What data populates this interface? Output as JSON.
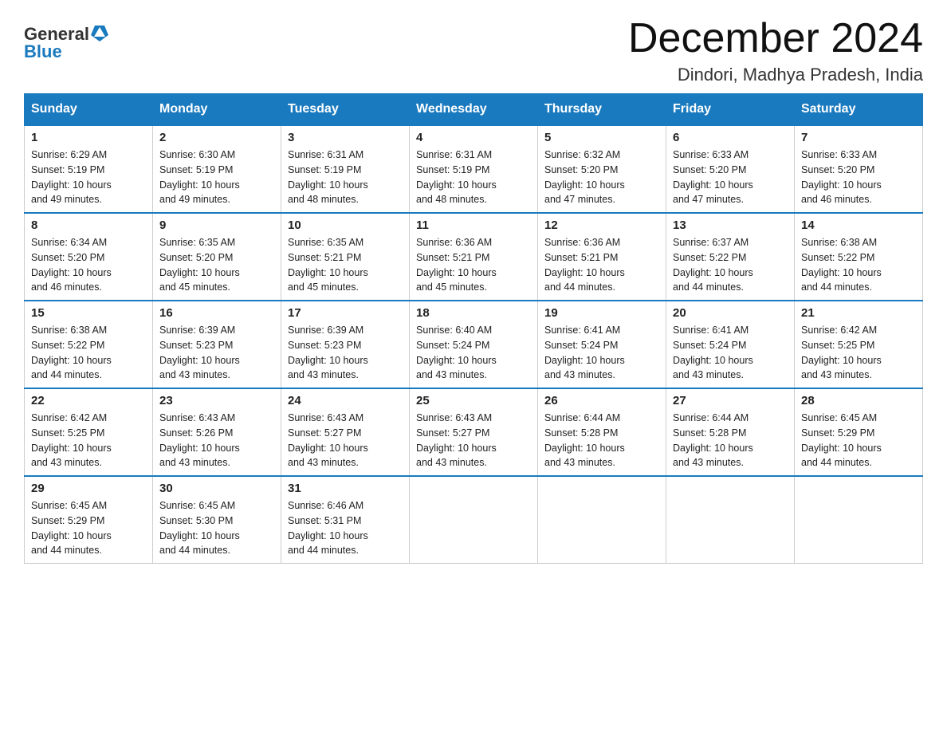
{
  "header": {
    "logo_text_general": "General",
    "logo_text_blue": "Blue",
    "month_title": "December 2024",
    "location": "Dindori, Madhya Pradesh, India"
  },
  "weekdays": [
    "Sunday",
    "Monday",
    "Tuesday",
    "Wednesday",
    "Thursday",
    "Friday",
    "Saturday"
  ],
  "weeks": [
    [
      {
        "day": "1",
        "sunrise": "6:29 AM",
        "sunset": "5:19 PM",
        "daylight": "10 hours and 49 minutes."
      },
      {
        "day": "2",
        "sunrise": "6:30 AM",
        "sunset": "5:19 PM",
        "daylight": "10 hours and 49 minutes."
      },
      {
        "day": "3",
        "sunrise": "6:31 AM",
        "sunset": "5:19 PM",
        "daylight": "10 hours and 48 minutes."
      },
      {
        "day": "4",
        "sunrise": "6:31 AM",
        "sunset": "5:19 PM",
        "daylight": "10 hours and 48 minutes."
      },
      {
        "day": "5",
        "sunrise": "6:32 AM",
        "sunset": "5:20 PM",
        "daylight": "10 hours and 47 minutes."
      },
      {
        "day": "6",
        "sunrise": "6:33 AM",
        "sunset": "5:20 PM",
        "daylight": "10 hours and 47 minutes."
      },
      {
        "day": "7",
        "sunrise": "6:33 AM",
        "sunset": "5:20 PM",
        "daylight": "10 hours and 46 minutes."
      }
    ],
    [
      {
        "day": "8",
        "sunrise": "6:34 AM",
        "sunset": "5:20 PM",
        "daylight": "10 hours and 46 minutes."
      },
      {
        "day": "9",
        "sunrise": "6:35 AM",
        "sunset": "5:20 PM",
        "daylight": "10 hours and 45 minutes."
      },
      {
        "day": "10",
        "sunrise": "6:35 AM",
        "sunset": "5:21 PM",
        "daylight": "10 hours and 45 minutes."
      },
      {
        "day": "11",
        "sunrise": "6:36 AM",
        "sunset": "5:21 PM",
        "daylight": "10 hours and 45 minutes."
      },
      {
        "day": "12",
        "sunrise": "6:36 AM",
        "sunset": "5:21 PM",
        "daylight": "10 hours and 44 minutes."
      },
      {
        "day": "13",
        "sunrise": "6:37 AM",
        "sunset": "5:22 PM",
        "daylight": "10 hours and 44 minutes."
      },
      {
        "day": "14",
        "sunrise": "6:38 AM",
        "sunset": "5:22 PM",
        "daylight": "10 hours and 44 minutes."
      }
    ],
    [
      {
        "day": "15",
        "sunrise": "6:38 AM",
        "sunset": "5:22 PM",
        "daylight": "10 hours and 44 minutes."
      },
      {
        "day": "16",
        "sunrise": "6:39 AM",
        "sunset": "5:23 PM",
        "daylight": "10 hours and 43 minutes."
      },
      {
        "day": "17",
        "sunrise": "6:39 AM",
        "sunset": "5:23 PM",
        "daylight": "10 hours and 43 minutes."
      },
      {
        "day": "18",
        "sunrise": "6:40 AM",
        "sunset": "5:24 PM",
        "daylight": "10 hours and 43 minutes."
      },
      {
        "day": "19",
        "sunrise": "6:41 AM",
        "sunset": "5:24 PM",
        "daylight": "10 hours and 43 minutes."
      },
      {
        "day": "20",
        "sunrise": "6:41 AM",
        "sunset": "5:24 PM",
        "daylight": "10 hours and 43 minutes."
      },
      {
        "day": "21",
        "sunrise": "6:42 AM",
        "sunset": "5:25 PM",
        "daylight": "10 hours and 43 minutes."
      }
    ],
    [
      {
        "day": "22",
        "sunrise": "6:42 AM",
        "sunset": "5:25 PM",
        "daylight": "10 hours and 43 minutes."
      },
      {
        "day": "23",
        "sunrise": "6:43 AM",
        "sunset": "5:26 PM",
        "daylight": "10 hours and 43 minutes."
      },
      {
        "day": "24",
        "sunrise": "6:43 AM",
        "sunset": "5:27 PM",
        "daylight": "10 hours and 43 minutes."
      },
      {
        "day": "25",
        "sunrise": "6:43 AM",
        "sunset": "5:27 PM",
        "daylight": "10 hours and 43 minutes."
      },
      {
        "day": "26",
        "sunrise": "6:44 AM",
        "sunset": "5:28 PM",
        "daylight": "10 hours and 43 minutes."
      },
      {
        "day": "27",
        "sunrise": "6:44 AM",
        "sunset": "5:28 PM",
        "daylight": "10 hours and 43 minutes."
      },
      {
        "day": "28",
        "sunrise": "6:45 AM",
        "sunset": "5:29 PM",
        "daylight": "10 hours and 44 minutes."
      }
    ],
    [
      {
        "day": "29",
        "sunrise": "6:45 AM",
        "sunset": "5:29 PM",
        "daylight": "10 hours and 44 minutes."
      },
      {
        "day": "30",
        "sunrise": "6:45 AM",
        "sunset": "5:30 PM",
        "daylight": "10 hours and 44 minutes."
      },
      {
        "day": "31",
        "sunrise": "6:46 AM",
        "sunset": "5:31 PM",
        "daylight": "10 hours and 44 minutes."
      },
      null,
      null,
      null,
      null
    ]
  ],
  "labels": {
    "sunrise": "Sunrise:",
    "sunset": "Sunset:",
    "daylight": "Daylight:"
  }
}
